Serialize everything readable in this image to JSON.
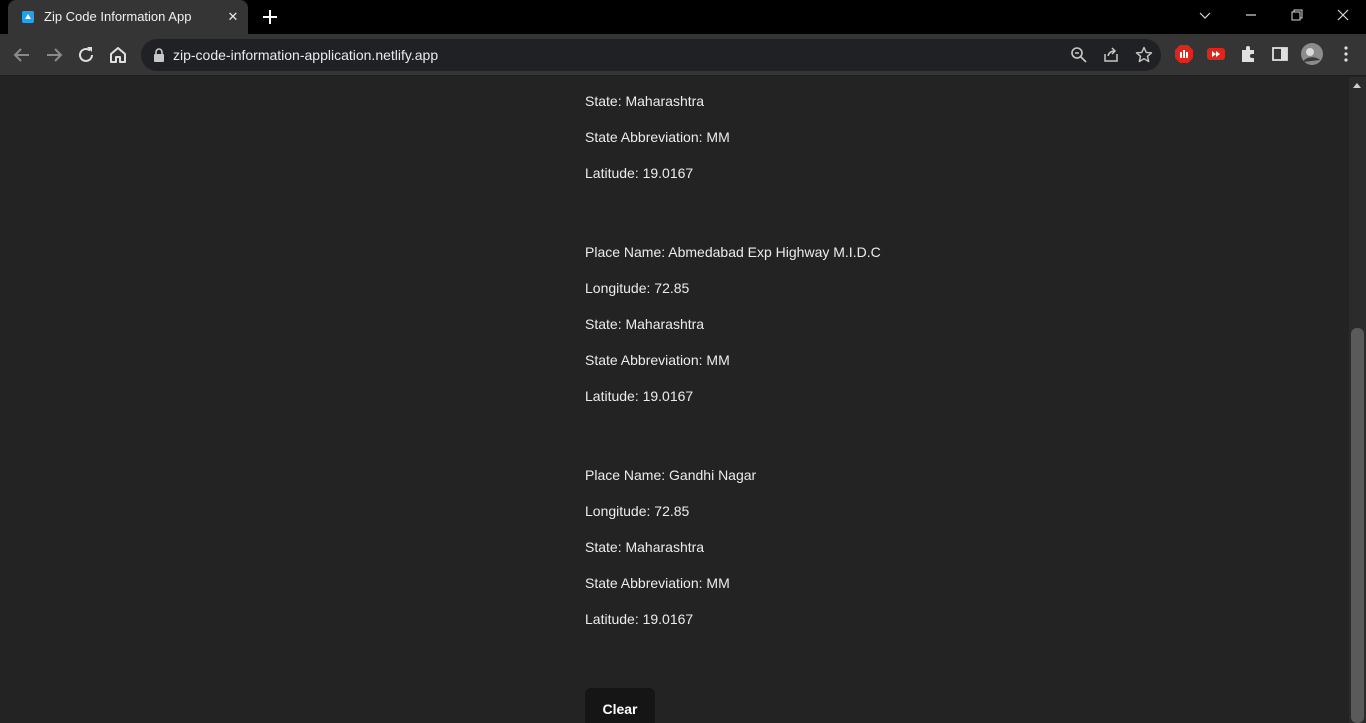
{
  "browser": {
    "tab_title": "Zip Code Information App",
    "url": "zip-code-information-application.netlify.app"
  },
  "records": [
    {
      "lines": [
        "State: Maharashtra",
        "State Abbreviation: MM",
        "Latitude: 19.0167"
      ]
    },
    {
      "lines": [
        "Place Name: Abmedabad Exp Highway M.I.D.C",
        "Longitude: 72.85",
        "State: Maharashtra",
        "State Abbreviation: MM",
        "Latitude: 19.0167"
      ]
    },
    {
      "lines": [
        "Place Name: Gandhi Nagar",
        "Longitude: 72.85",
        "State: Maharashtra",
        "State Abbreviation: MM",
        "Latitude: 19.0167"
      ]
    }
  ],
  "clear_button": "Clear",
  "colors": {
    "page_background": "#232323",
    "text": "#ececec",
    "button_background": "#151515"
  }
}
